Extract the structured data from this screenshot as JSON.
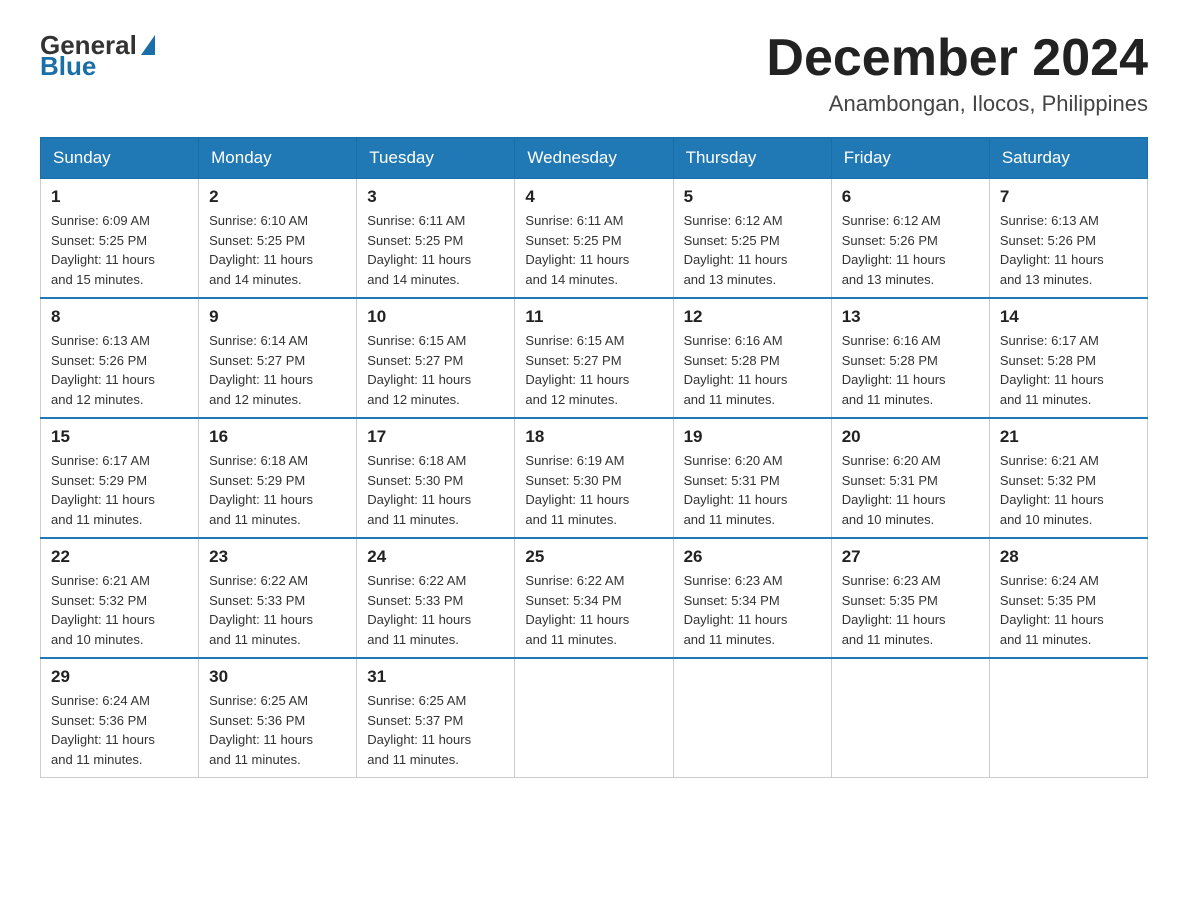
{
  "logo": {
    "general": "General",
    "blue": "Blue"
  },
  "title": {
    "month_year": "December 2024",
    "location": "Anambongan, Ilocos, Philippines"
  },
  "headers": [
    "Sunday",
    "Monday",
    "Tuesday",
    "Wednesday",
    "Thursday",
    "Friday",
    "Saturday"
  ],
  "weeks": [
    [
      {
        "day": "1",
        "info": "Sunrise: 6:09 AM\nSunset: 5:25 PM\nDaylight: 11 hours\nand 15 minutes."
      },
      {
        "day": "2",
        "info": "Sunrise: 6:10 AM\nSunset: 5:25 PM\nDaylight: 11 hours\nand 14 minutes."
      },
      {
        "day": "3",
        "info": "Sunrise: 6:11 AM\nSunset: 5:25 PM\nDaylight: 11 hours\nand 14 minutes."
      },
      {
        "day": "4",
        "info": "Sunrise: 6:11 AM\nSunset: 5:25 PM\nDaylight: 11 hours\nand 14 minutes."
      },
      {
        "day": "5",
        "info": "Sunrise: 6:12 AM\nSunset: 5:25 PM\nDaylight: 11 hours\nand 13 minutes."
      },
      {
        "day": "6",
        "info": "Sunrise: 6:12 AM\nSunset: 5:26 PM\nDaylight: 11 hours\nand 13 minutes."
      },
      {
        "day": "7",
        "info": "Sunrise: 6:13 AM\nSunset: 5:26 PM\nDaylight: 11 hours\nand 13 minutes."
      }
    ],
    [
      {
        "day": "8",
        "info": "Sunrise: 6:13 AM\nSunset: 5:26 PM\nDaylight: 11 hours\nand 12 minutes."
      },
      {
        "day": "9",
        "info": "Sunrise: 6:14 AM\nSunset: 5:27 PM\nDaylight: 11 hours\nand 12 minutes."
      },
      {
        "day": "10",
        "info": "Sunrise: 6:15 AM\nSunset: 5:27 PM\nDaylight: 11 hours\nand 12 minutes."
      },
      {
        "day": "11",
        "info": "Sunrise: 6:15 AM\nSunset: 5:27 PM\nDaylight: 11 hours\nand 12 minutes."
      },
      {
        "day": "12",
        "info": "Sunrise: 6:16 AM\nSunset: 5:28 PM\nDaylight: 11 hours\nand 11 minutes."
      },
      {
        "day": "13",
        "info": "Sunrise: 6:16 AM\nSunset: 5:28 PM\nDaylight: 11 hours\nand 11 minutes."
      },
      {
        "day": "14",
        "info": "Sunrise: 6:17 AM\nSunset: 5:28 PM\nDaylight: 11 hours\nand 11 minutes."
      }
    ],
    [
      {
        "day": "15",
        "info": "Sunrise: 6:17 AM\nSunset: 5:29 PM\nDaylight: 11 hours\nand 11 minutes."
      },
      {
        "day": "16",
        "info": "Sunrise: 6:18 AM\nSunset: 5:29 PM\nDaylight: 11 hours\nand 11 minutes."
      },
      {
        "day": "17",
        "info": "Sunrise: 6:18 AM\nSunset: 5:30 PM\nDaylight: 11 hours\nand 11 minutes."
      },
      {
        "day": "18",
        "info": "Sunrise: 6:19 AM\nSunset: 5:30 PM\nDaylight: 11 hours\nand 11 minutes."
      },
      {
        "day": "19",
        "info": "Sunrise: 6:20 AM\nSunset: 5:31 PM\nDaylight: 11 hours\nand 11 minutes."
      },
      {
        "day": "20",
        "info": "Sunrise: 6:20 AM\nSunset: 5:31 PM\nDaylight: 11 hours\nand 10 minutes."
      },
      {
        "day": "21",
        "info": "Sunrise: 6:21 AM\nSunset: 5:32 PM\nDaylight: 11 hours\nand 10 minutes."
      }
    ],
    [
      {
        "day": "22",
        "info": "Sunrise: 6:21 AM\nSunset: 5:32 PM\nDaylight: 11 hours\nand 10 minutes."
      },
      {
        "day": "23",
        "info": "Sunrise: 6:22 AM\nSunset: 5:33 PM\nDaylight: 11 hours\nand 11 minutes."
      },
      {
        "day": "24",
        "info": "Sunrise: 6:22 AM\nSunset: 5:33 PM\nDaylight: 11 hours\nand 11 minutes."
      },
      {
        "day": "25",
        "info": "Sunrise: 6:22 AM\nSunset: 5:34 PM\nDaylight: 11 hours\nand 11 minutes."
      },
      {
        "day": "26",
        "info": "Sunrise: 6:23 AM\nSunset: 5:34 PM\nDaylight: 11 hours\nand 11 minutes."
      },
      {
        "day": "27",
        "info": "Sunrise: 6:23 AM\nSunset: 5:35 PM\nDaylight: 11 hours\nand 11 minutes."
      },
      {
        "day": "28",
        "info": "Sunrise: 6:24 AM\nSunset: 5:35 PM\nDaylight: 11 hours\nand 11 minutes."
      }
    ],
    [
      {
        "day": "29",
        "info": "Sunrise: 6:24 AM\nSunset: 5:36 PM\nDaylight: 11 hours\nand 11 minutes."
      },
      {
        "day": "30",
        "info": "Sunrise: 6:25 AM\nSunset: 5:36 PM\nDaylight: 11 hours\nand 11 minutes."
      },
      {
        "day": "31",
        "info": "Sunrise: 6:25 AM\nSunset: 5:37 PM\nDaylight: 11 hours\nand 11 minutes."
      },
      {
        "day": "",
        "info": ""
      },
      {
        "day": "",
        "info": ""
      },
      {
        "day": "",
        "info": ""
      },
      {
        "day": "",
        "info": ""
      }
    ]
  ]
}
